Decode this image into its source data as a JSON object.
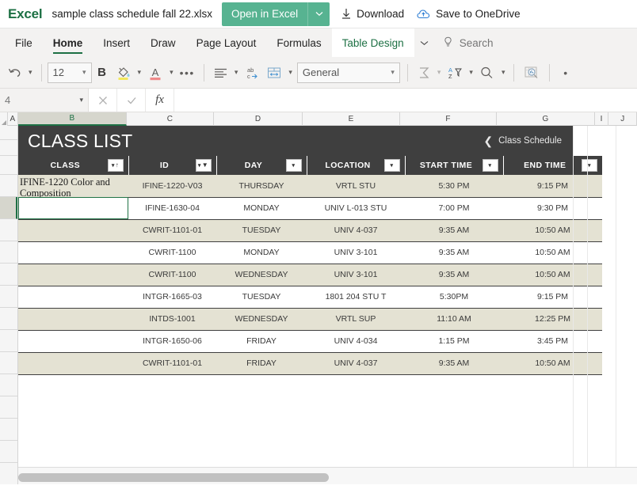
{
  "topbar": {
    "app_name": "Excel",
    "document_title": "sample class schedule fall 22.xlsx",
    "open_in_excel_label": "Open in Excel",
    "download_label": "Download",
    "save_to_onedrive_label": "Save to OneDrive",
    "accent_green": "#57b391",
    "logo_green": "#1d7044"
  },
  "ribbon": {
    "tabs": [
      {
        "label": "File"
      },
      {
        "label": "Home"
      },
      {
        "label": "Insert"
      },
      {
        "label": "Draw"
      },
      {
        "label": "Page Layout"
      },
      {
        "label": "Formulas"
      },
      {
        "label": "Table Design"
      }
    ],
    "active_tab": "Table Design",
    "emphasized_tab": "Home",
    "search_placeholder": "Search"
  },
  "toolbar": {
    "font_size": "12",
    "bold_label": "B",
    "number_format": "General",
    "more_label": "•••"
  },
  "formula_bar": {
    "name_box": "4",
    "cancel_label": "✕",
    "confirm_label": "✓",
    "fx_label": "fx",
    "formula_value": ""
  },
  "grid": {
    "column_headers": [
      "A",
      "B",
      "C",
      "D",
      "E",
      "F",
      "G",
      "I",
      "J"
    ],
    "selected_column": "B"
  },
  "table": {
    "title": "CLASS LIST",
    "back_link": "Class Schedule",
    "back_chevron": "❮",
    "header_bg": "#3f3f3f",
    "band_bg": "#e4e2d3",
    "columns": [
      {
        "label": "CLASS",
        "filter_state": "sorted-asc"
      },
      {
        "label": "ID",
        "filter_state": "filtered"
      },
      {
        "label": "DAY",
        "filter_state": "none"
      },
      {
        "label": "LOCATION",
        "filter_state": "none"
      },
      {
        "label": "START TIME",
        "filter_state": "none"
      },
      {
        "label": "END TIME",
        "filter_state": "none"
      }
    ],
    "overflow_text": "IFINE-1220 Color and Composition",
    "rows": [
      {
        "class": "",
        "id": "IFINE-1220-V03",
        "day": "THURSDAY",
        "location": "VRTL STU",
        "start": "5:30 PM",
        "end": "9:15 PM"
      },
      {
        "class": "",
        "id": "IFINE-1630-04",
        "day": "MONDAY",
        "location": "UNIV L-013 STU",
        "start": "7:00 PM",
        "end": "9:30 PM"
      },
      {
        "class": "",
        "id": "CWRIT-1101-01",
        "day": "TUESDAY",
        "location": "UNIV 4-037",
        "start": "9:35 AM",
        "end": "10:50 AM"
      },
      {
        "class": "",
        "id": "CWRIT-1100",
        "day": "MONDAY",
        "location": "UNIV 3-101",
        "start": "9:35 AM",
        "end": "10:50 AM"
      },
      {
        "class": "",
        "id": "CWRIT-1100",
        "day": "WEDNESDAY",
        "location": "UNIV 3-101",
        "start": "9:35 AM",
        "end": "10:50 AM"
      },
      {
        "class": "",
        "id": "INTGR-1665-03",
        "day": "TUESDAY",
        "location": "1801 204 STU T",
        "start": "5:30PM",
        "end": "9:15 PM"
      },
      {
        "class": "",
        "id": "INTDS-1001",
        "day": "WEDNESDAY",
        "location": "VRTL SUP",
        "start": "11:10 AM",
        "end": "12:25 PM"
      },
      {
        "class": "",
        "id": "INTGR-1650-06",
        "day": "FRIDAY",
        "location": "UNIV 4-034",
        "start": "1:15 PM",
        "end": "3:45 PM"
      },
      {
        "class": "",
        "id": "CWRIT-1101-01",
        "day": "FRIDAY",
        "location": "UNIV 4-037",
        "start": "9:35 AM",
        "end": "10:50 AM"
      }
    ],
    "active_cell_row_index": 1,
    "selection_color": "#217346"
  }
}
